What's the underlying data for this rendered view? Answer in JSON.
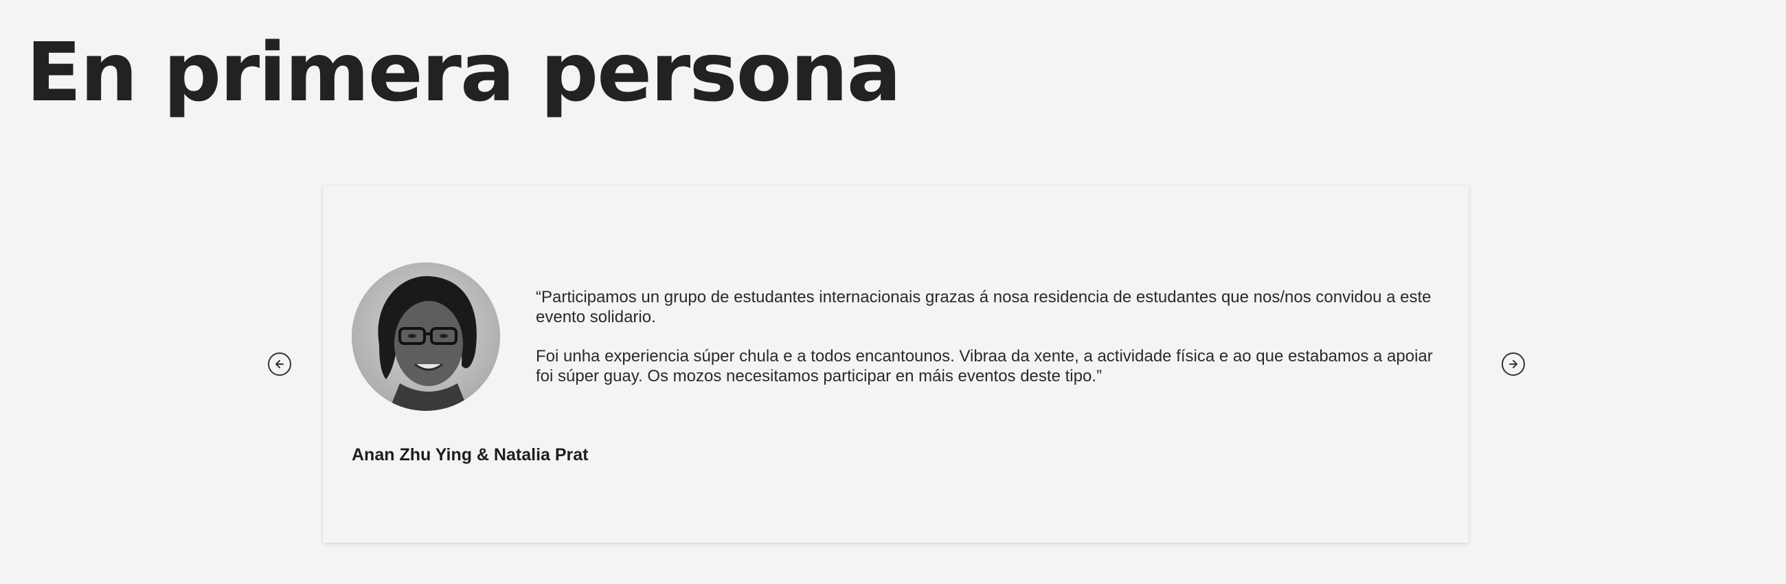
{
  "page": {
    "title": "En primera persona"
  },
  "testimonial": {
    "quote_paragraphs": [
      "“Participamos un grupo de estudantes internacionais grazas á nosa residencia de estudantes que nos/nos convidou a este evento solidario.",
      "Foi unha experiencia súper chula e a todos encantounos. Vibraa da xente, a actividade física e ao que estabamos a apoiar foi súper guay. Os mozos necesitamos participar en máis eventos deste tipo.”"
    ],
    "author": "Anan Zhu Ying & Natalia Prat",
    "avatar_icon": "person-photo"
  },
  "navigation": {
    "prev_icon": "arrow-left-circle-icon",
    "next_icon": "arrow-right-circle-icon"
  },
  "colors": {
    "background": "#f4f4f4",
    "text": "#222222"
  }
}
